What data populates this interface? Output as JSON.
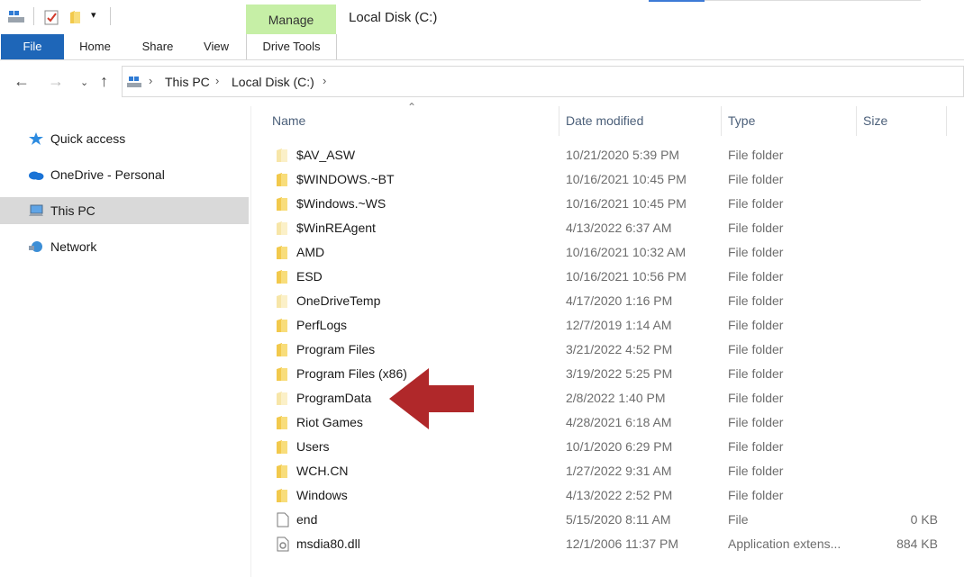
{
  "window": {
    "title": "Local Disk (C:)",
    "contextual_tab_group": "Manage"
  },
  "ribbon": {
    "tabs": [
      {
        "label": "File",
        "active": true
      },
      {
        "label": "Home"
      },
      {
        "label": "Share"
      },
      {
        "label": "View"
      },
      {
        "label": "Drive Tools"
      }
    ]
  },
  "address_bar": {
    "breadcrumbs": [
      "This PC",
      "Local Disk (C:)"
    ]
  },
  "sidebar": {
    "items": [
      {
        "label": "Quick access",
        "icon": "star-icon"
      },
      {
        "label": "OneDrive - Personal",
        "icon": "cloud-icon"
      },
      {
        "label": "This PC",
        "icon": "computer-icon",
        "selected": true
      },
      {
        "label": "Network",
        "icon": "network-icon"
      }
    ]
  },
  "file_list": {
    "columns": [
      "Name",
      "Date modified",
      "Type",
      "Size"
    ],
    "sort_column": "Name",
    "rows": [
      {
        "name": "$AV_ASW",
        "date": "10/21/2020 5:39 PM",
        "type": "File folder",
        "size": "",
        "icon": "folder-faded"
      },
      {
        "name": "$WINDOWS.~BT",
        "date": "10/16/2021 10:45 PM",
        "type": "File folder",
        "size": "",
        "icon": "folder"
      },
      {
        "name": "$Windows.~WS",
        "date": "10/16/2021 10:45 PM",
        "type": "File folder",
        "size": "",
        "icon": "folder"
      },
      {
        "name": "$WinREAgent",
        "date": "4/13/2022 6:37 AM",
        "type": "File folder",
        "size": "",
        "icon": "folder-faded"
      },
      {
        "name": "AMD",
        "date": "10/16/2021 10:32 AM",
        "type": "File folder",
        "size": "",
        "icon": "folder"
      },
      {
        "name": "ESD",
        "date": "10/16/2021 10:56 PM",
        "type": "File folder",
        "size": "",
        "icon": "folder"
      },
      {
        "name": "OneDriveTemp",
        "date": "4/17/2020 1:16 PM",
        "type": "File folder",
        "size": "",
        "icon": "folder-faded"
      },
      {
        "name": "PerfLogs",
        "date": "12/7/2019 1:14 AM",
        "type": "File folder",
        "size": "",
        "icon": "folder"
      },
      {
        "name": "Program Files",
        "date": "3/21/2022 4:52 PM",
        "type": "File folder",
        "size": "",
        "icon": "folder"
      },
      {
        "name": "Program Files (x86)",
        "date": "3/19/2022 5:25 PM",
        "type": "File folder",
        "size": "",
        "icon": "folder"
      },
      {
        "name": "ProgramData",
        "date": "2/8/2022 1:40 PM",
        "type": "File folder",
        "size": "",
        "icon": "folder-faded"
      },
      {
        "name": "Riot Games",
        "date": "4/28/2021 6:18 AM",
        "type": "File folder",
        "size": "",
        "icon": "folder"
      },
      {
        "name": "Users",
        "date": "10/1/2020 6:29 PM",
        "type": "File folder",
        "size": "",
        "icon": "folder"
      },
      {
        "name": "WCH.CN",
        "date": "1/27/2022 9:31 AM",
        "type": "File folder",
        "size": "",
        "icon": "folder"
      },
      {
        "name": "Windows",
        "date": "4/13/2022 2:52 PM",
        "type": "File folder",
        "size": "",
        "icon": "folder"
      },
      {
        "name": "end",
        "date": "5/15/2020 8:11 AM",
        "type": "File",
        "size": "0 KB",
        "icon": "file"
      },
      {
        "name": "msdia80.dll",
        "date": "12/1/2006 11:37 PM",
        "type": "Application extens...",
        "size": "884 KB",
        "icon": "dll-file"
      }
    ]
  },
  "annotation": {
    "icon": "red-arrow-icon",
    "color": "#b0282a",
    "points_to": "ProgramData"
  },
  "colors": {
    "file_tab": "#1e66b8",
    "manage_tab": "#c6efa6",
    "selected_nav": "#d9d9d9",
    "folder": "#f2c94c"
  }
}
